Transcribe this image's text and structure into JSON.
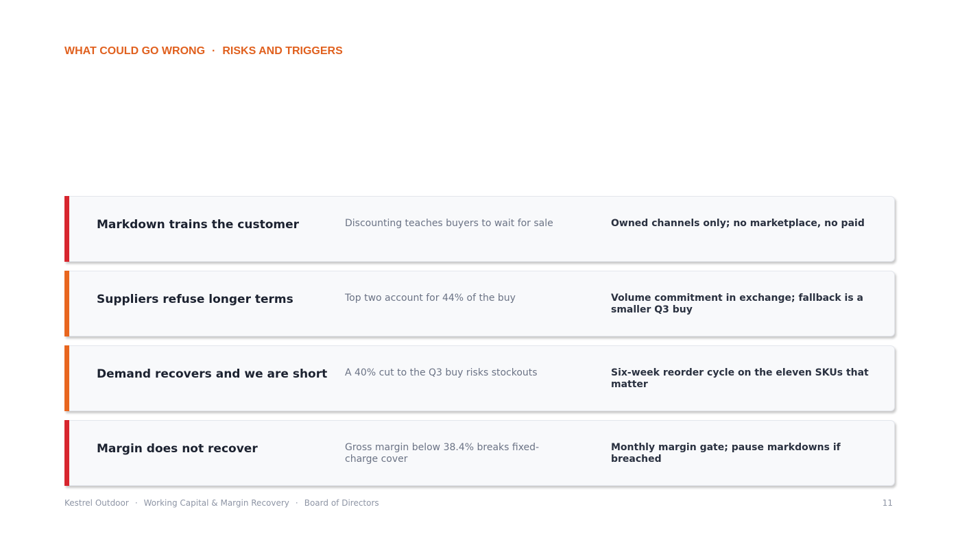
{
  "header": {
    "section": "WHAT COULD GO WRONG",
    "separator": "·",
    "title": "RISKS AND TRIGGERS"
  },
  "colors": {
    "kicker": "#e0601e",
    "red": "#d7262e",
    "orange": "#e8661f"
  },
  "risks": [
    {
      "risk": "Markdown trains the customer",
      "cause": "Discounting teaches buyers to wait for sale",
      "mitigation": "Owned channels only; no marketplace, no paid",
      "severity_color": "#d7262e"
    },
    {
      "risk": "Suppliers refuse longer terms",
      "cause": "Top two account for 44% of the buy",
      "mitigation": "Volume commitment in exchange; fallback is a smaller Q3 buy",
      "severity_color": "#e8661f"
    },
    {
      "risk": "Demand recovers and we are short",
      "cause": "A 40% cut to the Q3 buy risks stockouts",
      "mitigation": "Six-week reorder cycle on the eleven SKUs that matter",
      "severity_color": "#e8661f"
    },
    {
      "risk": "Margin does not recover",
      "cause": "Gross margin below 38.4% breaks fixed-charge cover",
      "mitigation": "Monthly margin gate; pause markdowns if breached",
      "severity_color": "#d7262e"
    }
  ],
  "footer": {
    "company": "Kestrel Outdoor",
    "deck": "Working Capital & Margin Recovery",
    "audience": "Board of Directors",
    "separator": "·",
    "page": "11"
  }
}
